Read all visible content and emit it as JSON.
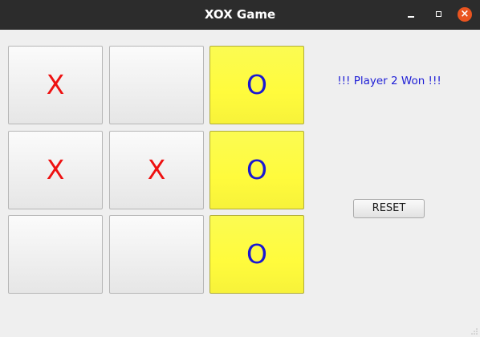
{
  "window": {
    "title": "XOX Game",
    "controls": {
      "minimize": "minimize",
      "maximize": "maximize",
      "close": "×"
    }
  },
  "board": {
    "cells": [
      {
        "mark": "X",
        "winning": false
      },
      {
        "mark": "",
        "winning": false
      },
      {
        "mark": "O",
        "winning": true
      },
      {
        "mark": "X",
        "winning": false
      },
      {
        "mark": "X",
        "winning": false
      },
      {
        "mark": "O",
        "winning": true
      },
      {
        "mark": "",
        "winning": false
      },
      {
        "mark": "",
        "winning": false
      },
      {
        "mark": "O",
        "winning": true
      }
    ]
  },
  "status": {
    "text": "!!! Player 2 Won !!!",
    "color": "#1e1ed6"
  },
  "reset": {
    "label": "RESET"
  },
  "colors": {
    "x_mark": "#ee1111",
    "o_mark": "#1a18d2",
    "win_highlight": "#fffb3c",
    "titlebar": "#2c2c2c",
    "close_button": "#e95420"
  }
}
